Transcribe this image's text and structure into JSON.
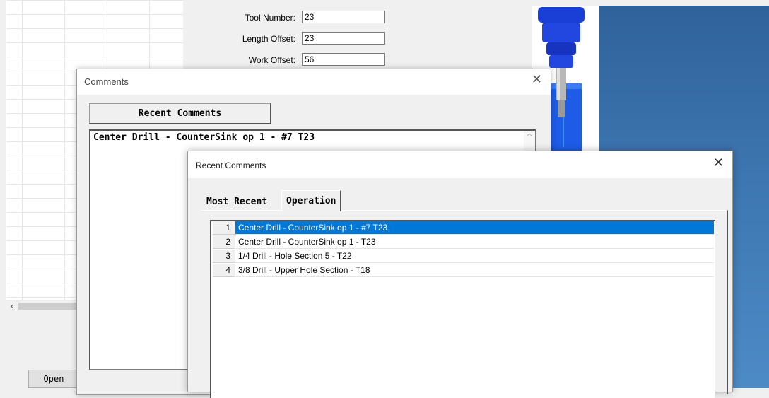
{
  "background_app": {
    "form": {
      "tool_number_label": "Tool Number:",
      "tool_number_value": "23",
      "length_offset_label": "Length Offset:",
      "length_offset_value": "23",
      "work_offset_label": "Work Offset:",
      "work_offset_value": "56"
    },
    "open_button": "Open",
    "scroll_left_icon": "‹"
  },
  "comments_dialog": {
    "title": "Comments",
    "recent_comments_button": "Recent Comments",
    "comment_text": "Center Drill - CounterSink op 1 - #7 T23"
  },
  "recent_dialog": {
    "title": "Recent Comments",
    "tabs": [
      {
        "label": "Most Recent",
        "active": false
      },
      {
        "label": "Operation",
        "active": true
      }
    ],
    "rows": [
      {
        "num": "1",
        "text": "Center Drill - CounterSink op 1 - #7 T23",
        "selected": true
      },
      {
        "num": "2",
        "text": "Center Drill - CounterSink op 1 - T23",
        "selected": false
      },
      {
        "num": "3",
        "text": "1/4 Drill - Hole Section 5 - T22",
        "selected": false
      },
      {
        "num": "4",
        "text": "3/8 Drill - Upper Hole Section - T18",
        "selected": false
      }
    ]
  },
  "colors": {
    "selection": "#0078d7",
    "viewport_bg_top": "#30629a",
    "tool_blue": "#1a3fd6",
    "stock_blue": "#1e5ce8",
    "wire_cyan": "#3fe0ea"
  }
}
